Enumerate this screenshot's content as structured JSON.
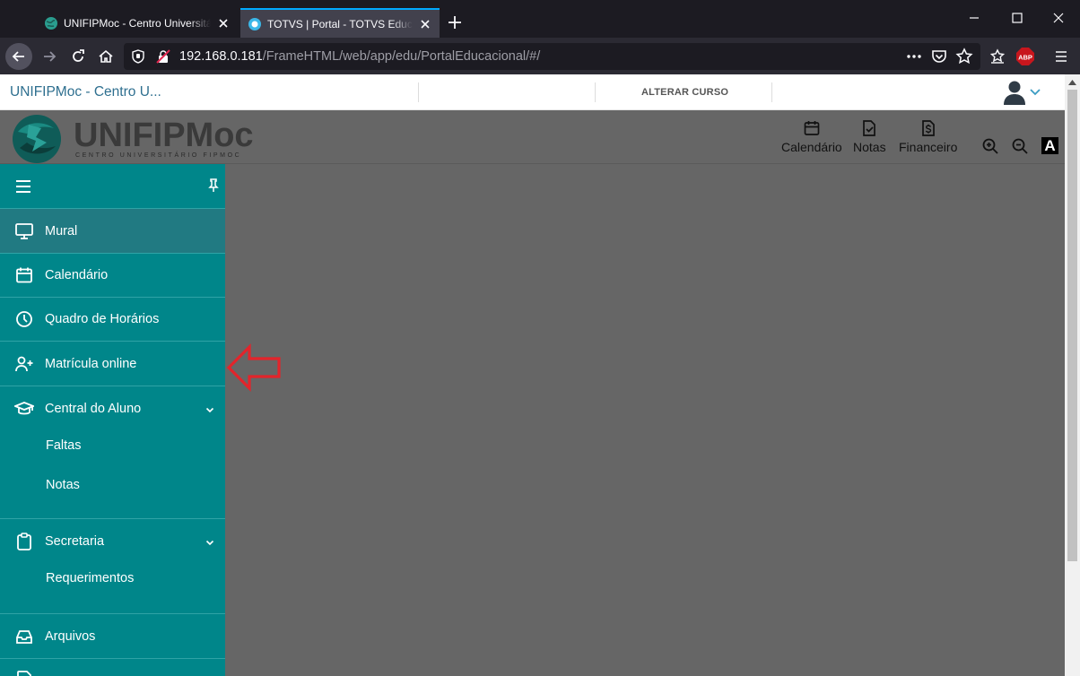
{
  "browser": {
    "tabs": [
      {
        "title": "UNIFIPMoc - Centro Universitário FIPMoc",
        "active": false
      },
      {
        "title": "TOTVS | Portal - TOTVS Educacional",
        "active": true
      }
    ],
    "url_host": "192.168.0.181",
    "url_path": "/FrameHTML/web/app/edu/PortalEducacional/#/",
    "extension_badge": "ABP"
  },
  "portal": {
    "institution": "UNIFIPMoc - Centro U...",
    "change_course": "ALTERAR CURSO",
    "logo_text": "UNIFIPMoc",
    "logo_subtext": "CENTRO UNIVERSITÁRIO FIPMOC",
    "shortcuts": [
      {
        "label": "Calendário",
        "icon": "calendar-icon"
      },
      {
        "label": "Notas",
        "icon": "grades-icon"
      },
      {
        "label": "Financeiro",
        "icon": "finance-icon"
      }
    ],
    "font_toggle": "A"
  },
  "sidebar": {
    "items": [
      {
        "label": "Mural",
        "icon": "monitor-icon"
      },
      {
        "label": "Calendário",
        "icon": "calendar-icon"
      },
      {
        "label": "Quadro de Horários",
        "icon": "clock-icon"
      },
      {
        "label": "Matrícula online",
        "icon": "user-plus-icon"
      },
      {
        "label": "Central do Aluno",
        "icon": "graduation-cap-icon"
      },
      {
        "label": "Secretaria",
        "icon": "clipboard-icon"
      },
      {
        "label": "Arquivos",
        "icon": "inbox-icon"
      }
    ],
    "central_sub": [
      "Faltas",
      "Notas"
    ],
    "secretaria_sub": [
      "Requerimentos"
    ]
  },
  "colors": {
    "sidebar": "#00868a",
    "sidebar_active": "#217a82",
    "annotation_arrow": "#e3242b",
    "page_bg": "#666666"
  }
}
